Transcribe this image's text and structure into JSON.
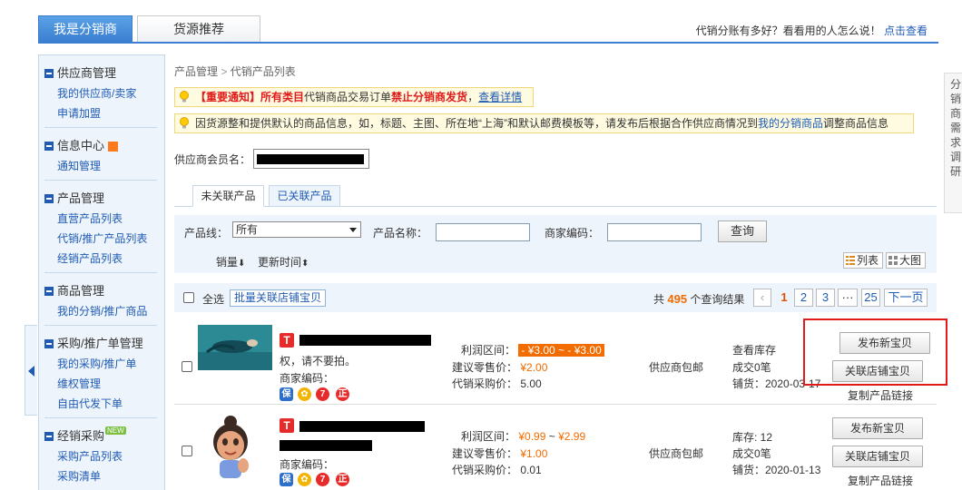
{
  "top_tabs": {
    "active": "我是分销商",
    "inactive": "货源推荐"
  },
  "top_right": {
    "text": "代销分账有多好？看看用的人怎么说！",
    "link": "点击查看"
  },
  "sidebar": {
    "groups": [
      {
        "title": "供应商管理",
        "items": [
          "我的供应商/卖家",
          "申请加盟"
        ]
      },
      {
        "title": "信息中心",
        "items": [
          "通知管理"
        ]
      },
      {
        "title": "产品管理",
        "items": [
          "直营产品列表",
          "代销/推广产品列表",
          "经销产品列表"
        ]
      },
      {
        "title": "商品管理",
        "items": [
          "我的分销/推广商品"
        ]
      },
      {
        "title": "采购/推广单管理",
        "items": [
          "我的采购/推广单",
          "维权管理",
          "自由代发下单"
        ]
      },
      {
        "title": "经销采购",
        "badge": "NEW",
        "items": [
          "采购产品列表",
          "采购清单"
        ]
      }
    ]
  },
  "breadcrumb": {
    "root": "产品管理",
    "sep": ">",
    "current": "代销产品列表"
  },
  "notice1": {
    "tag": "【重要通知】",
    "part1": "所有类目",
    "part2": "代销商品交易订单",
    "part3": "禁止分销商发货",
    "sep": "，",
    "link": "查看详情"
  },
  "notice2": {
    "text": "因货源整和提供默认的商品信息，如，标题、主图、所在地“上海”和默认邮费模板等，请发布后根据合作供应商情况到",
    "link": "我的分销商品",
    "tail": "调整商品信息"
  },
  "supplier": {
    "label": "供应商会员名："
  },
  "sub_tabs": {
    "active": "未关联产品",
    "inactive": "已关联产品"
  },
  "filter": {
    "line_label": "产品线：",
    "line_value": "所有",
    "name_label": "产品名称：",
    "code_label": "商家编码：",
    "query": "查询",
    "sort_sales": "销量",
    "sort_time": "更新时间",
    "view_list": "列表",
    "view_grid": "大图"
  },
  "toolbar": {
    "select_all": "全选",
    "batch": "批量关联店铺宝贝",
    "total_prefix": "共",
    "total": "495",
    "total_suffix": "个查询结果",
    "pages": [
      "1",
      "2",
      "3",
      "···",
      "25"
    ],
    "next": "下一页"
  },
  "rows": [
    {
      "title_tail": "权，请不要拍。",
      "code_label": "商家编码：",
      "profit_label": "利润区间：",
      "profit": "- ¥3.00 ~ - ¥3.00",
      "retail_label": "建议零售价：",
      "retail": "¥2.00",
      "cost_label": "代销采购价：",
      "cost": "5.00",
      "shipping": "供应商包邮",
      "stock": "查看库存",
      "deals": "成交0笔",
      "listed": "铺货：2020-03-17",
      "btn_publish": "发布新宝贝",
      "btn_link": "关联店铺宝贝",
      "copy_link": "复制产品链接"
    },
    {
      "title_tail": "",
      "code_label": "商家编码：",
      "profit_label": "利润区间：",
      "profit_low": "¥0.99",
      "profit_sep": "~",
      "profit_high": "¥2.99",
      "retail_label": "建议零售价：",
      "retail": "¥1.00",
      "cost_label": "代销采购价：",
      "cost": "0.01",
      "shipping": "供应商包邮",
      "stock": "库存: 12",
      "deals": "成交0笔",
      "listed": "铺货：2020-01-13",
      "btn_publish": "发布新宝贝",
      "btn_link": "关联店铺宝贝",
      "copy_link": "复制产品链接"
    }
  ],
  "right_panel": {
    "chars": [
      "分",
      "销",
      "商",
      "需",
      "求",
      "调",
      "研"
    ]
  },
  "colors": {
    "accent": "#3a7fd1",
    "link": "#1f5bb3",
    "price": "#f26c00",
    "alert": "#e01b1b"
  }
}
